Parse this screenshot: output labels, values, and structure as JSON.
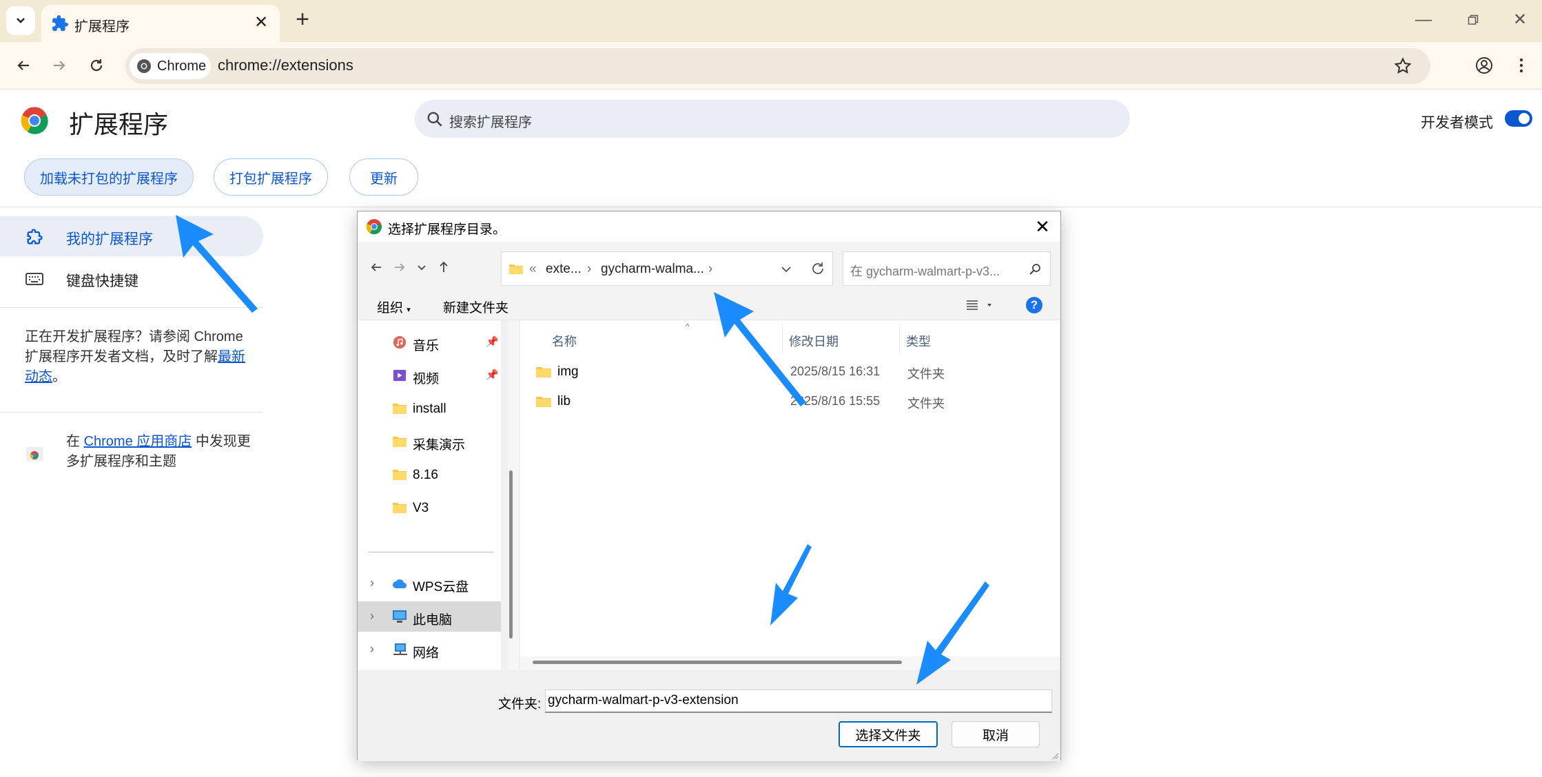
{
  "browser": {
    "tab_title": "扩展程序",
    "chip_label": "Chrome",
    "url": "chrome://extensions"
  },
  "page": {
    "title": "扩展程序",
    "search_placeholder": "搜索扩展程序",
    "developer_mode_label": "开发者模式",
    "developer_mode_on": true,
    "buttons": {
      "load_unpacked": "加载未打包的扩展程序",
      "pack": "打包扩展程序",
      "update": "更新"
    },
    "sidebar": {
      "my_extensions": "我的扩展程序",
      "keyboard_shortcuts": "键盘快捷键",
      "dev_info_prefix": "正在开发扩展程序？请参阅 Chrome 扩展程序开发者文档，及时了解",
      "dev_info_link": "最新动态",
      "dev_info_suffix": "。",
      "store_prefix": "在 ",
      "store_link": "Chrome 应用商店",
      "store_suffix": " 中发现更多扩展程序和主题"
    }
  },
  "dialog": {
    "title": "选择扩展程序目录。",
    "breadcrumb": {
      "overflow": "«",
      "part1": "exte...",
      "part2": "gycharm-walma...",
      "sep": "›"
    },
    "search_placeholder": "在 gycharm-walmart-p-v3...",
    "organize": "组织",
    "new_folder": "新建文件夹",
    "help": "?",
    "nav_items": [
      {
        "label": "音乐",
        "pinned": true
      },
      {
        "label": "视频",
        "pinned": true
      },
      {
        "label": "install"
      },
      {
        "label": "采集演示"
      },
      {
        "label": "8.16"
      },
      {
        "label": "V3"
      },
      {
        "label": "WPS云盘"
      },
      {
        "label": "此电脑"
      },
      {
        "label": "网络"
      }
    ],
    "columns": {
      "name": "名称",
      "date": "修改日期",
      "type": "类型"
    },
    "files": [
      {
        "name": "img",
        "date": "2025/8/15 16:31",
        "type": "文件夹"
      },
      {
        "name": "lib",
        "date": "2025/8/16 15:55",
        "type": "文件夹"
      }
    ],
    "folder_label": "文件夹:",
    "folder_value": "gycharm-walmart-p-v3-extension",
    "select_button": "选择文件夹",
    "cancel_button": "取消"
  },
  "colors": {
    "accent": "#0b57d0",
    "annotation_arrow": "#1a8cff",
    "tabstrip": "#f3ead4"
  }
}
